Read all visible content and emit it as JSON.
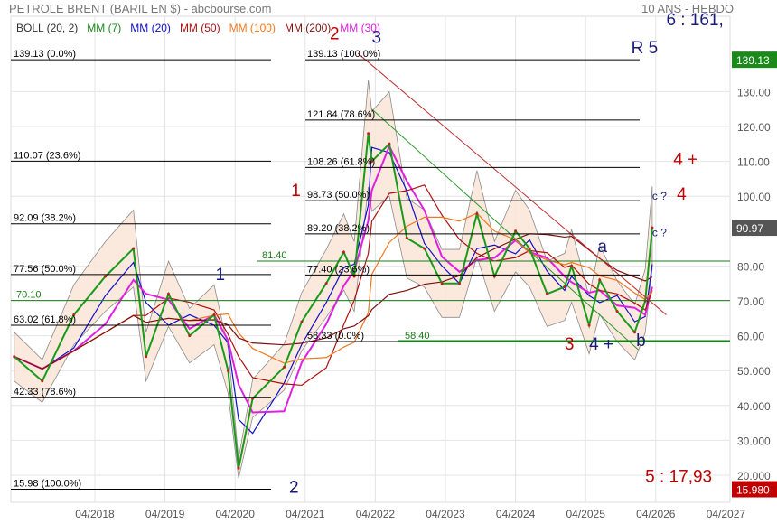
{
  "header": {
    "title": "PETROLE BRENT (BARIL EN $) - abcbourse.com",
    "period": "10 ANS - HEBDO"
  },
  "legend": [
    {
      "label": "BOLL (20, 2)",
      "color": "#333333"
    },
    {
      "label": "MM (7)",
      "color": "#1a8a1a"
    },
    {
      "label": "MM (20)",
      "color": "#1010cc"
    },
    {
      "label": "MM (50)",
      "color": "#b01010"
    },
    {
      "label": "MM (100)",
      "color": "#f07820"
    },
    {
      "label": "MM (200)",
      "color": "#801010"
    },
    {
      "label": "MM (30)",
      "color": "#e020e0"
    }
  ],
  "chart_data": {
    "type": "line",
    "title": "PETROLE BRENT (BARIL EN $)",
    "ylim": [
      15,
      145
    ],
    "y_ticks": [
      "130.00",
      "120.00",
      "110.00",
      "100.00",
      "80.00",
      "70.00",
      "60.00",
      "50.000",
      "40.000",
      "30.000",
      "20.000"
    ],
    "y_tick_values": [
      130,
      120,
      110,
      100,
      80,
      70,
      60,
      50,
      40,
      30,
      20
    ],
    "x_ticks": [
      "04/2018",
      "04/2019",
      "04/2020",
      "04/2021",
      "04/2022",
      "04/2023",
      "04/2024",
      "04/2025",
      "04/2026",
      "04/2027"
    ],
    "x_tick_values": [
      2018.25,
      2019.25,
      2020.25,
      2021.25,
      2022.25,
      2023.25,
      2024.25,
      2025.25,
      2026.25,
      2027.25
    ],
    "xlim": [
      2017.05,
      2027.3
    ],
    "price_series": {
      "name": "Brent",
      "x": [
        2017.1,
        2017.5,
        2017.95,
        2018.4,
        2018.8,
        2018.98,
        2019.3,
        2019.6,
        2019.95,
        2020.15,
        2020.3,
        2020.5,
        2020.95,
        2021.2,
        2021.55,
        2021.8,
        2021.95,
        2022.15,
        2022.2,
        2022.45,
        2022.7,
        2022.95,
        2023.2,
        2023.45,
        2023.7,
        2023.95,
        2024.25,
        2024.45,
        2024.7,
        2024.95,
        2025.05,
        2025.3,
        2025.45,
        2025.7,
        2025.95,
        2026.1,
        2026.2
      ],
      "values": [
        54,
        47,
        66,
        77,
        85,
        54,
        72,
        60,
        66,
        50,
        22,
        42,
        51,
        64,
        75,
        84,
        77,
        118,
        110,
        115,
        88,
        85,
        75,
        75,
        95,
        77,
        90,
        85,
        72,
        74,
        80,
        63,
        76,
        67,
        61,
        70,
        91
      ]
    },
    "current_price": {
      "label": "90.97",
      "value": 90.97,
      "color": "#555555"
    },
    "high_marker": {
      "label": "139.13",
      "value": 139.13,
      "color": "#1a8a1a"
    },
    "low_marker": {
      "label": "15.980",
      "value": 15.98,
      "color": "#c00000"
    },
    "fib_left": [
      {
        "label": "139.13  (0.0%)",
        "value": 139.13
      },
      {
        "label": "110.07  (23.6%)",
        "value": 110.07
      },
      {
        "label": "92.09  (38.2%)",
        "value": 92.09
      },
      {
        "label": "77.56  (50.0%)",
        "value": 77.56
      },
      {
        "label": "63.02  (61.8%)",
        "value": 63.02
      },
      {
        "label": "42.33  (78.6%)",
        "value": 42.33
      },
      {
        "label": "15.98  (100.0%)",
        "value": 15.98
      }
    ],
    "fib_right": [
      {
        "label": "139.13  (100.0%)",
        "value": 139.13
      },
      {
        "label": "121.84  (78.6%)",
        "value": 121.84
      },
      {
        "label": "108.26  (61.8%)",
        "value": 108.26
      },
      {
        "label": "98.73  (50.0%)",
        "value": 98.73
      },
      {
        "label": "89.20  (38.2%)",
        "value": 89.2
      },
      {
        "label": "77.40  (23.6%)",
        "value": 77.4
      },
      {
        "label": "58.33  (0.0%)",
        "value": 58.33
      }
    ],
    "support_lines": [
      {
        "label": "81.40",
        "value": 81.4
      },
      {
        "label": "70.10",
        "value": 70.1
      },
      {
        "label": "58.40",
        "value": 58.4
      }
    ],
    "annotations": [
      {
        "text": "1",
        "color": "#c00000",
        "x": 2021.05,
        "y": 100
      },
      {
        "text": "2",
        "color": "#c00000",
        "x": 2021.6,
        "y": 145
      },
      {
        "text": "3",
        "color": "#1a1a7a",
        "x": 2022.2,
        "y": 144
      },
      {
        "text": "R 5",
        "color": "#1a1a7a",
        "x": 2025.9,
        "y": 141
      },
      {
        "text": "4 +",
        "color": "#c00000",
        "x": 2026.5,
        "y": 109
      },
      {
        "text": "4",
        "color": "#c00000",
        "x": 2026.55,
        "y": 99
      },
      {
        "text": "c ?",
        "color": "#1a1a7a",
        "x": 2026.2,
        "y": 99
      },
      {
        "text": "c ?",
        "color": "#1a1a7a",
        "x": 2026.2,
        "y": 88.5
      },
      {
        "text": "a",
        "color": "#1a1a7a",
        "x": 2025.42,
        "y": 84
      },
      {
        "text": "3",
        "color": "#c00000",
        "x": 2024.95,
        "y": 56
      },
      {
        "text": "4 +",
        "color": "#1a1a7a",
        "x": 2025.3,
        "y": 56
      },
      {
        "text": "b",
        "color": "#1a1a7a",
        "x": 2025.97,
        "y": 57
      },
      {
        "text": "1",
        "color": "#1a1a7a",
        "x": 2019.97,
        "y": 76
      },
      {
        "text": "2",
        "color": "#1a1a7a",
        "x": 2021.02,
        "y": 15
      },
      {
        "text": "5 : 17,93",
        "color": "#c00000",
        "x": 2026.1,
        "y": 18
      },
      {
        "text": "6 : 161,",
        "color": "#1a1a7a",
        "x": 2026.4,
        "y": 149
      }
    ]
  }
}
